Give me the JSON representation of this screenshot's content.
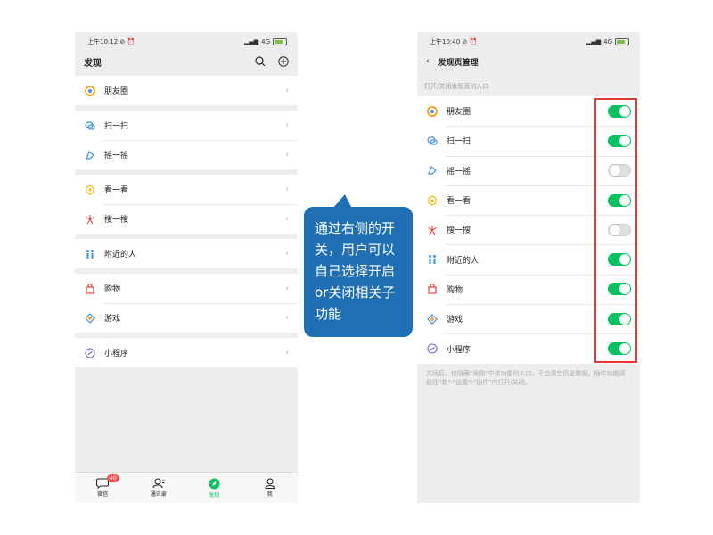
{
  "left_phone": {
    "status": {
      "time": "上午10:12 ⊘ ⏰",
      "network": "4G"
    },
    "nav_title": "发现",
    "groups": [
      [
        {
          "label": "朋友圈"
        }
      ],
      [
        {
          "label": "扫一扫"
        },
        {
          "label": "摇一摇"
        }
      ],
      [
        {
          "label": "看一看"
        },
        {
          "label": "搜一搜"
        }
      ],
      [
        {
          "label": "附近的人"
        }
      ],
      [
        {
          "label": "购物"
        },
        {
          "label": "游戏"
        }
      ],
      [
        {
          "label": "小程序"
        }
      ]
    ],
    "tabs": [
      {
        "label": "微信",
        "badge": "40"
      },
      {
        "label": "通讯录"
      },
      {
        "label": "发现"
      },
      {
        "label": "我"
      }
    ]
  },
  "callout": {
    "text": "通过右侧的开关，用户可以自己选择开启or关闭相关子功能"
  },
  "right_phone": {
    "status": {
      "time": "上午10:40 ⊘ ⏰",
      "network": "4G"
    },
    "nav_title": "发现页管理",
    "section_title": "打开/关闭发现页的入口",
    "items": [
      {
        "label": "朋友圈",
        "on": true
      },
      {
        "label": "扫一扫",
        "on": true
      },
      {
        "label": "摇一摇",
        "on": false
      },
      {
        "label": "看一看",
        "on": true
      },
      {
        "label": "搜一搜",
        "on": false
      },
      {
        "label": "附近的人",
        "on": true
      },
      {
        "label": "购物",
        "on": true
      },
      {
        "label": "游戏",
        "on": true
      },
      {
        "label": "小程序",
        "on": true
      }
    ],
    "footnote": "关闭后，仅隐藏\"发现\"中该功能的入口，不会清空历史数据。插件功能请前往\"我\"-\"设置\"-\"插件\"内打开/关闭。"
  },
  "colors": {
    "accent": "#07c160",
    "callout": "#1f6fb5",
    "highlight": "#e53935"
  }
}
